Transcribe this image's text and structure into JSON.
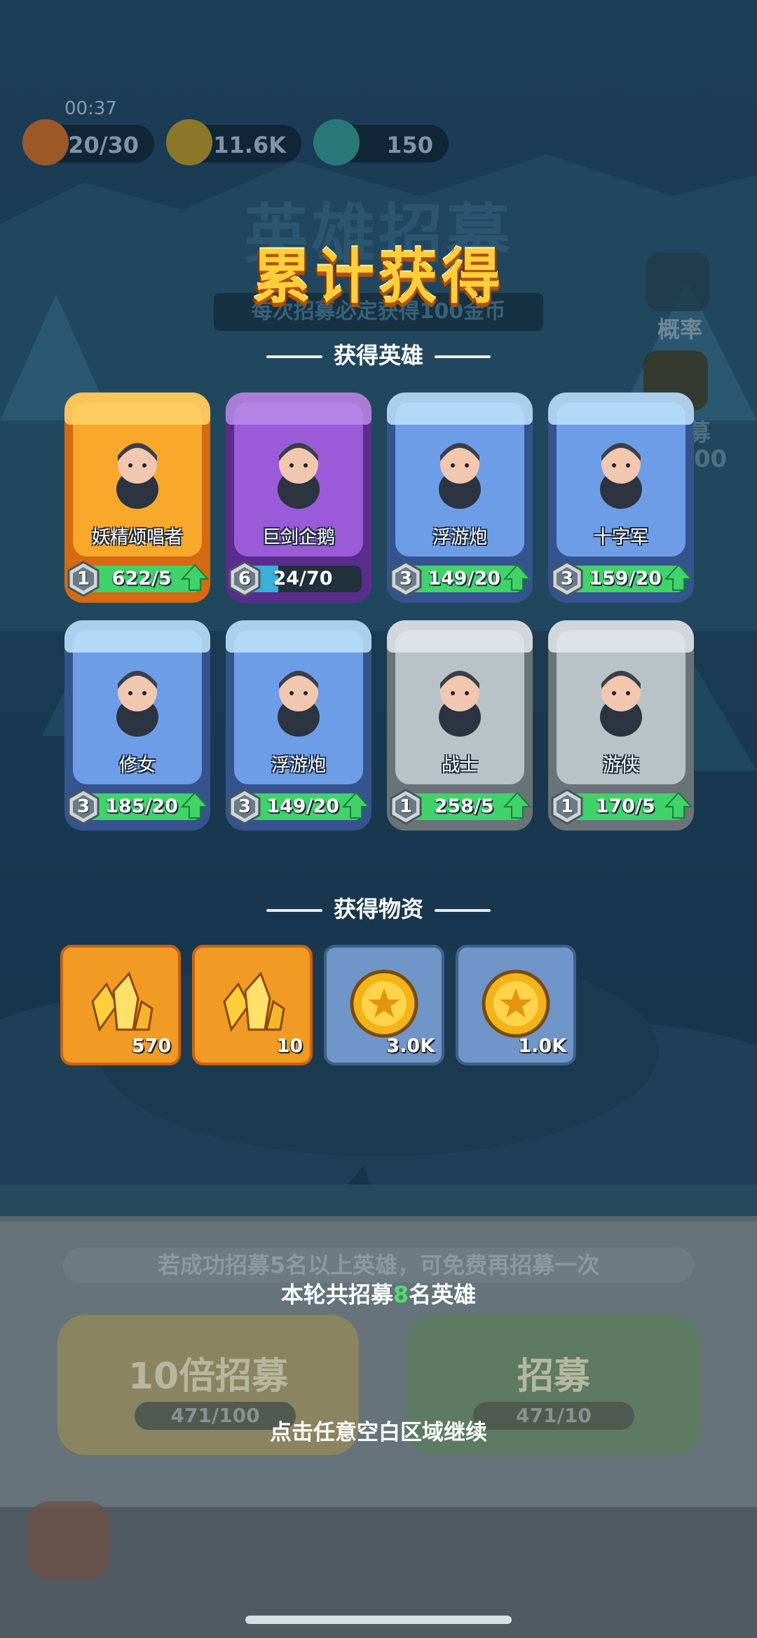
{
  "status": {
    "timer": "00:37"
  },
  "resources": [
    {
      "name": "energy",
      "icon": "flame-icon",
      "value": "20/30"
    },
    {
      "name": "gold",
      "icon": "gold-coin-icon",
      "value": "11.6K"
    },
    {
      "name": "crystal",
      "icon": "crystal-icon",
      "value": "150"
    }
  ],
  "background": {
    "title": "英雄招募",
    "subtitle": "每次招募必定获得100金币",
    "side_probability_label": "概率",
    "side_label_2": "募",
    "side_label_3": "00"
  },
  "reward_popup": {
    "title": "累计获得",
    "heroes_section": "获得英雄",
    "items_section": "获得物资",
    "heroes": [
      {
        "name": "妖精颂唱者",
        "level": "1",
        "progress": "622/5",
        "fraction": 1.0,
        "rarity": "legendary",
        "upgradable": true,
        "portrait": "fairy-singer-portrait"
      },
      {
        "name": "巨剑企鹅",
        "level": "6",
        "progress": "24/70",
        "fraction": 0.34,
        "rarity": "epic",
        "upgradable": false,
        "portrait": "sword-penguin-portrait"
      },
      {
        "name": "浮游炮",
        "level": "3",
        "progress": "149/20",
        "fraction": 1.0,
        "rarity": "rare",
        "upgradable": true,
        "portrait": "floating-cannon-portrait"
      },
      {
        "name": "十字军",
        "level": "3",
        "progress": "159/20",
        "fraction": 1.0,
        "rarity": "rare",
        "upgradable": true,
        "portrait": "crusader-portrait"
      },
      {
        "name": "修女",
        "level": "3",
        "progress": "185/20",
        "fraction": 1.0,
        "rarity": "rare",
        "upgradable": true,
        "portrait": "nun-portrait"
      },
      {
        "name": "浮游炮",
        "level": "3",
        "progress": "149/20",
        "fraction": 1.0,
        "rarity": "rare",
        "upgradable": true,
        "portrait": "floating-cannon-portrait"
      },
      {
        "name": "战士",
        "level": "1",
        "progress": "258/5",
        "fraction": 1.0,
        "rarity": "common",
        "upgradable": true,
        "portrait": "warrior-portrait"
      },
      {
        "name": "游侠",
        "level": "1",
        "progress": "170/5",
        "fraction": 1.0,
        "rarity": "common",
        "upgradable": true,
        "portrait": "ranger-portrait"
      }
    ],
    "items": [
      {
        "icon": "gold-crystal-icon",
        "quantity": "570",
        "rarity": "orange"
      },
      {
        "icon": "gold-crystal-icon",
        "quantity": "10",
        "rarity": "orange"
      },
      {
        "icon": "gold-coin-icon",
        "quantity": "3.0K",
        "rarity": "blue"
      },
      {
        "icon": "gold-coin-icon",
        "quantity": "1.0K",
        "rarity": "blue"
      }
    ],
    "summary_prefix": "本轮共招募",
    "summary_count": "8",
    "summary_suffix": "名英雄",
    "continue_hint": "点击任意空白区域继续"
  },
  "bottom": {
    "bonus_hint": "若成功招募5名以上英雄，可免费再招募一次",
    "ten_x_button": {
      "label": "10倍招募",
      "cost": "471/100"
    },
    "recruit_button": {
      "label": "招募",
      "cost": "471/10"
    }
  },
  "colors": {
    "title_gold": "#ffcf3b",
    "progress_green": "#3fd36a",
    "progress_blue": "#3ab0d8",
    "legendary": "#f59a1d",
    "epic": "#8a4fd0",
    "rare": "#5c8fe0",
    "common": "#a9b3b8"
  }
}
